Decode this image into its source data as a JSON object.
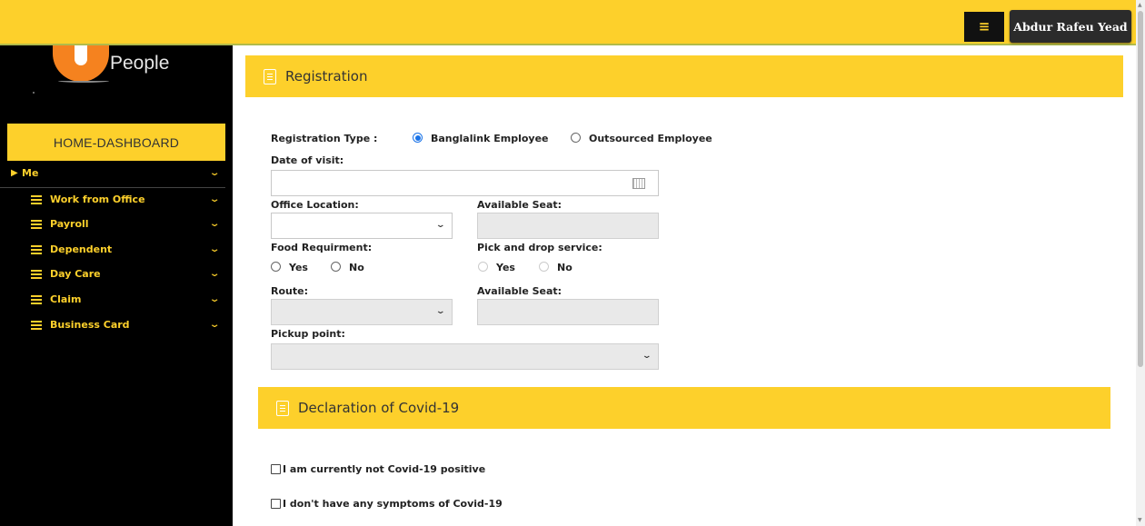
{
  "header": {
    "menu_icon": "hamburger-icon",
    "user_name": "Abdur Rafeu Yead",
    "accent_color": "#fdd02b"
  },
  "sidebar": {
    "logo_text": "People",
    "home_label": "HOME-DASHBOARD",
    "me_label": "Me",
    "items": [
      {
        "label": "Work from Office"
      },
      {
        "label": "Payroll"
      },
      {
        "label": "Dependent"
      },
      {
        "label": "Day Care"
      },
      {
        "label": "Claim"
      },
      {
        "label": "Business Card"
      }
    ]
  },
  "registration": {
    "section_title": "Registration",
    "type_label": "Registration Type :",
    "type_options": [
      "Banglalink Employee",
      "Outsourced Employee"
    ],
    "type_selected": "Banglalink Employee",
    "date_label": "Date of visit:",
    "date_value": "",
    "office_location_label": "Office Location:",
    "office_location_value": "",
    "available_seat_label": "Available Seat:",
    "food_label": "Food Requirment:",
    "food_options": [
      "Yes",
      "No"
    ],
    "pick_drop_label": "Pick and drop service:",
    "pick_drop_options": [
      "Yes",
      "No"
    ],
    "route_label": "Route:",
    "route_available_seat_label": "Available Seat:",
    "pickup_label": "Pickup point:"
  },
  "declaration": {
    "section_title": "Declaration of Covid-19",
    "items": [
      {
        "label": "I am currently not Covid-19 positive",
        "checked": false
      },
      {
        "label": "I don't have any symptoms of Covid-19",
        "checked": false
      }
    ]
  }
}
